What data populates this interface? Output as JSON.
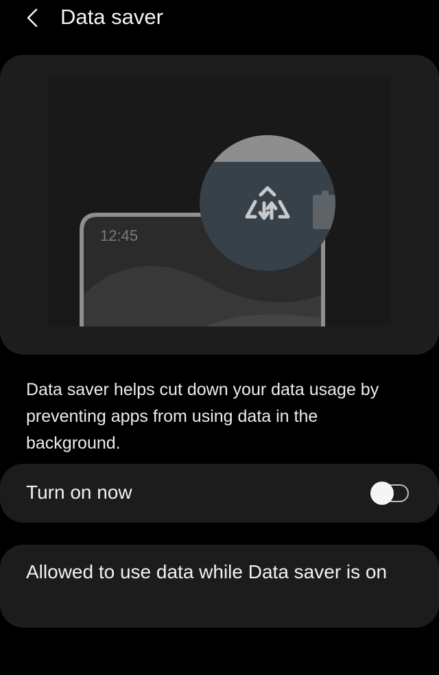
{
  "header": {
    "title": "Data saver",
    "back_icon": "chevron-left-icon"
  },
  "illustration": {
    "clock_time": "12:45",
    "badge_icon": "data-saver-icon",
    "status_icon": "battery-icon"
  },
  "description": "Data saver helps cut down your data usage by preventing apps from using data in the background.",
  "turn_on_now": {
    "label": "Turn on now",
    "state": "off"
  },
  "allowed_apps": {
    "label": "Allowed to use data while Data saver is on"
  },
  "colors": {
    "background": "#000000",
    "card": "#1c1c1c",
    "badge": "#36414a",
    "text": "#f2f2f2"
  }
}
